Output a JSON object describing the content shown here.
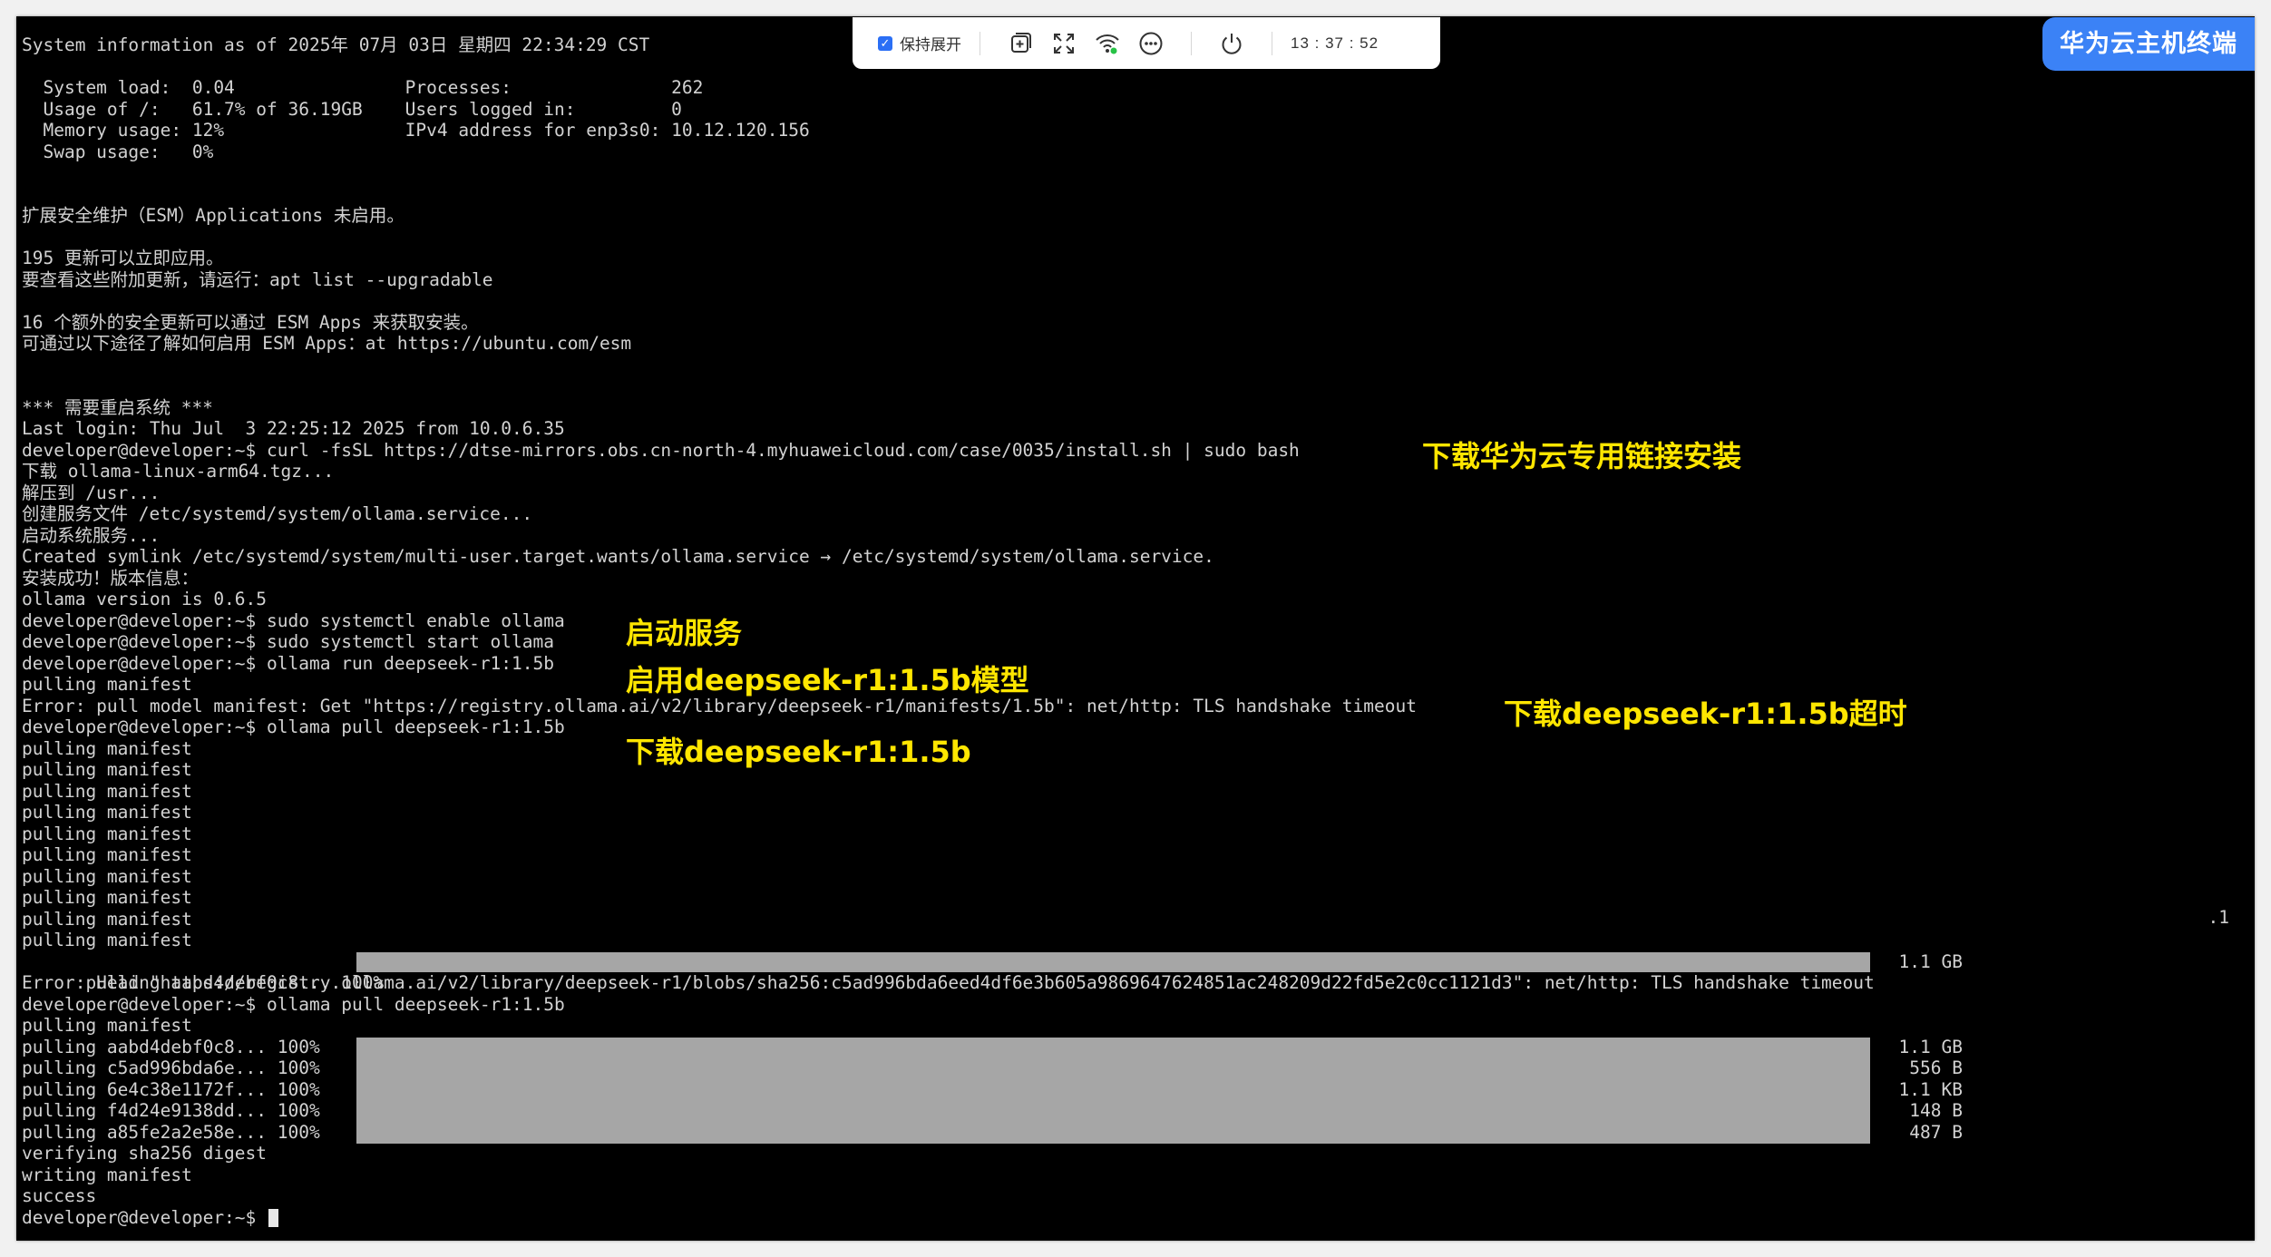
{
  "toolbar": {
    "keep_expanded_label": "保持展开",
    "clock": "13 : 37 : 52",
    "icons": [
      "add-window-icon",
      "fullscreen-icon",
      "network-signal-icon",
      "more-options-icon",
      "power-icon"
    ]
  },
  "brand": {
    "title": "华为云主机终端"
  },
  "colors": {
    "accent": "#3b82f6",
    "annotation": "#ffe600",
    "terminal_bg": "#000000"
  },
  "annotations": {
    "install_note": "下载华为云专用链接安装",
    "start_service_note": "启动服务",
    "run_model_note": "启用deepseek-r1:1.5b模型",
    "timeout_note": "下载deepseek-r1:1.5b超时",
    "pull_note": "下载deepseek-r1:1.5b"
  },
  "terminal": {
    "stray_char": ".1",
    "prompt_final": "developer@developer:~$ ",
    "lines": [
      "System information as of 2025年 07月 03日 星期四 22:34:29 CST",
      "",
      "  System load:  0.04                Processes:               262",
      "  Usage of /:   61.7% of 36.19GB    Users logged in:         0",
      "  Memory usage: 12%                 IPv4 address for enp3s0: 10.12.120.156",
      "  Swap usage:   0%",
      "",
      "",
      "扩展安全维护（ESM）Applications 未启用。",
      "",
      "195 更新可以立即应用。",
      "要查看这些附加更新，请运行：apt list --upgradable",
      "",
      "16 个额外的安全更新可以通过 ESM Apps 来获取安装。",
      "可通过以下途径了解如何启用 ESM Apps：at https://ubuntu.com/esm",
      "",
      "",
      "*** 需要重启系统 ***",
      "Last login: Thu Jul  3 22:25:12 2025 from 10.0.6.35",
      "developer@developer:~$ curl -fsSL https://dtse-mirrors.obs.cn-north-4.myhuaweicloud.com/case/0035/install.sh | sudo bash",
      "下载 ollama-linux-arm64.tgz...",
      "解压到 /usr...",
      "创建服务文件 /etc/systemd/system/ollama.service...",
      "启动系统服务...",
      "Created symlink /etc/systemd/system/multi-user.target.wants/ollama.service → /etc/systemd/system/ollama.service.",
      "安装成功！版本信息：",
      "ollama version is 0.6.5",
      "developer@developer:~$ sudo systemctl enable ollama",
      "developer@developer:~$ sudo systemctl start ollama",
      "developer@developer:~$ ollama run deepseek-r1:1.5b",
      "pulling manifest",
      "Error: pull model manifest: Get \"https://registry.ollama.ai/v2/library/deepseek-r1/manifests/1.5b\": net/http: TLS handshake timeout",
      "developer@developer:~$ ollama pull deepseek-r1:1.5b",
      "pulling manifest",
      "pulling manifest",
      "pulling manifest",
      "pulling manifest",
      "pulling manifest",
      "pulling manifest",
      "pulling manifest",
      "pulling manifest",
      "pulling manifest",
      "pulling manifest"
    ],
    "first_progress": {
      "label": "pulling aabd4debf0c8... 100%",
      "size": "1.1 GB"
    },
    "lines2": [
      "Error: Head \"https://registry.ollama.ai/v2/library/deepseek-r1/blobs/sha256:c5ad996bda6eed4df6e3b605a9869647624851ac248209d22fd5e2c0cc1121d3\": net/http: TLS handshake timeout",
      "developer@developer:~$ ollama pull deepseek-r1:1.5b",
      "pulling manifest"
    ],
    "progress": [
      {
        "label": "pulling aabd4debf0c8... 100%",
        "size": "1.1 GB"
      },
      {
        "label": "pulling c5ad996bda6e... 100%",
        "size": "556 B"
      },
      {
        "label": "pulling 6e4c38e1172f... 100%",
        "size": "1.1 KB"
      },
      {
        "label": "pulling f4d24e9138dd... 100%",
        "size": "148 B"
      },
      {
        "label": "pulling a85fe2a2e58e... 100%",
        "size": "487 B"
      }
    ],
    "lines3": [
      "verifying sha256 digest",
      "writing manifest",
      "success"
    ]
  }
}
